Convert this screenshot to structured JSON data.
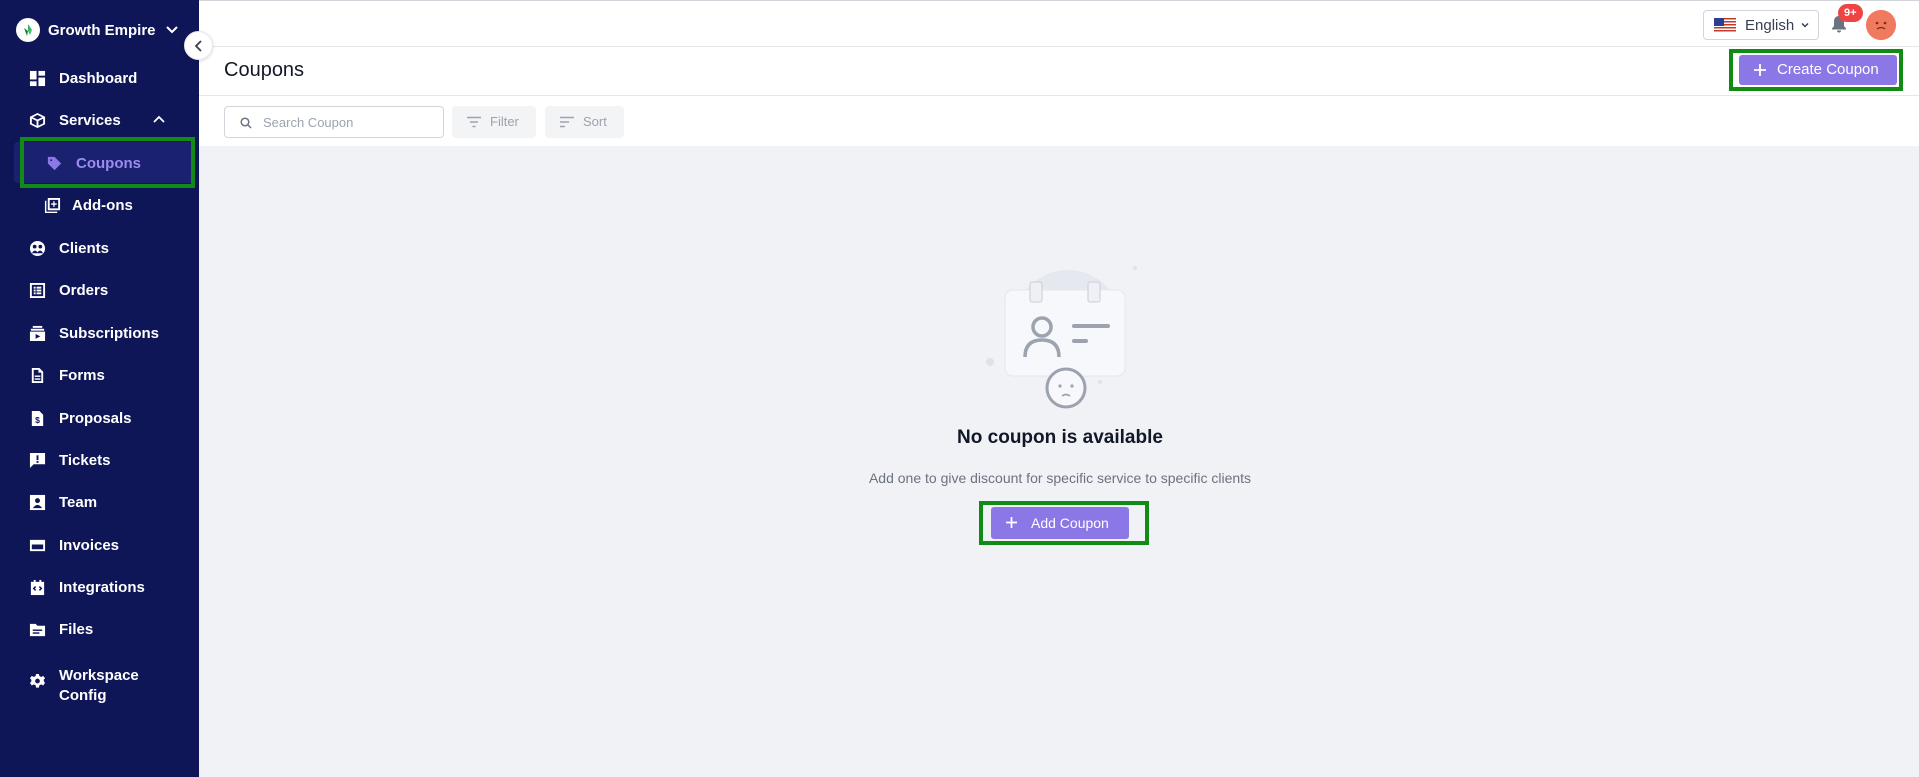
{
  "sidebar": {
    "brand_name": "Growth Empire",
    "items": [
      {
        "label": "Dashboard",
        "icon": "dashboard-icon"
      },
      {
        "label": "Services",
        "icon": "box-icon"
      },
      {
        "label": "Coupons",
        "icon": "tag-icon"
      },
      {
        "label": "Add-ons",
        "icon": "add-box-icon"
      },
      {
        "label": "Clients",
        "icon": "clients-icon"
      },
      {
        "label": "Orders",
        "icon": "orders-icon"
      },
      {
        "label": "Subscriptions",
        "icon": "subscriptions-icon"
      },
      {
        "label": "Forms",
        "icon": "form-icon"
      },
      {
        "label": "Proposals",
        "icon": "proposal-icon"
      },
      {
        "label": "Tickets",
        "icon": "ticket-icon"
      },
      {
        "label": "Team",
        "icon": "team-icon"
      },
      {
        "label": "Invoices",
        "icon": "invoice-icon"
      },
      {
        "label": "Integrations",
        "icon": "integrations-icon"
      },
      {
        "label": "Files",
        "icon": "folder-icon"
      },
      {
        "label": "Workspace Config",
        "icon": "gear-icon"
      }
    ]
  },
  "topbar": {
    "language": "English",
    "notification_count": "9+"
  },
  "page": {
    "title": "Coupons",
    "create_label": "Create Coupon"
  },
  "toolbar": {
    "search_placeholder": "Search Coupon",
    "filter_label": "Filter",
    "sort_label": "Sort"
  },
  "empty_state": {
    "title": "No coupon is available",
    "description": "Add one to give discount for specific service to specific clients",
    "add_label": "Add Coupon"
  },
  "colors": {
    "sidebar_bg": "#0f1657",
    "accent": "#8b78e6",
    "highlight": "#118a16",
    "badge": "#ef4444"
  }
}
